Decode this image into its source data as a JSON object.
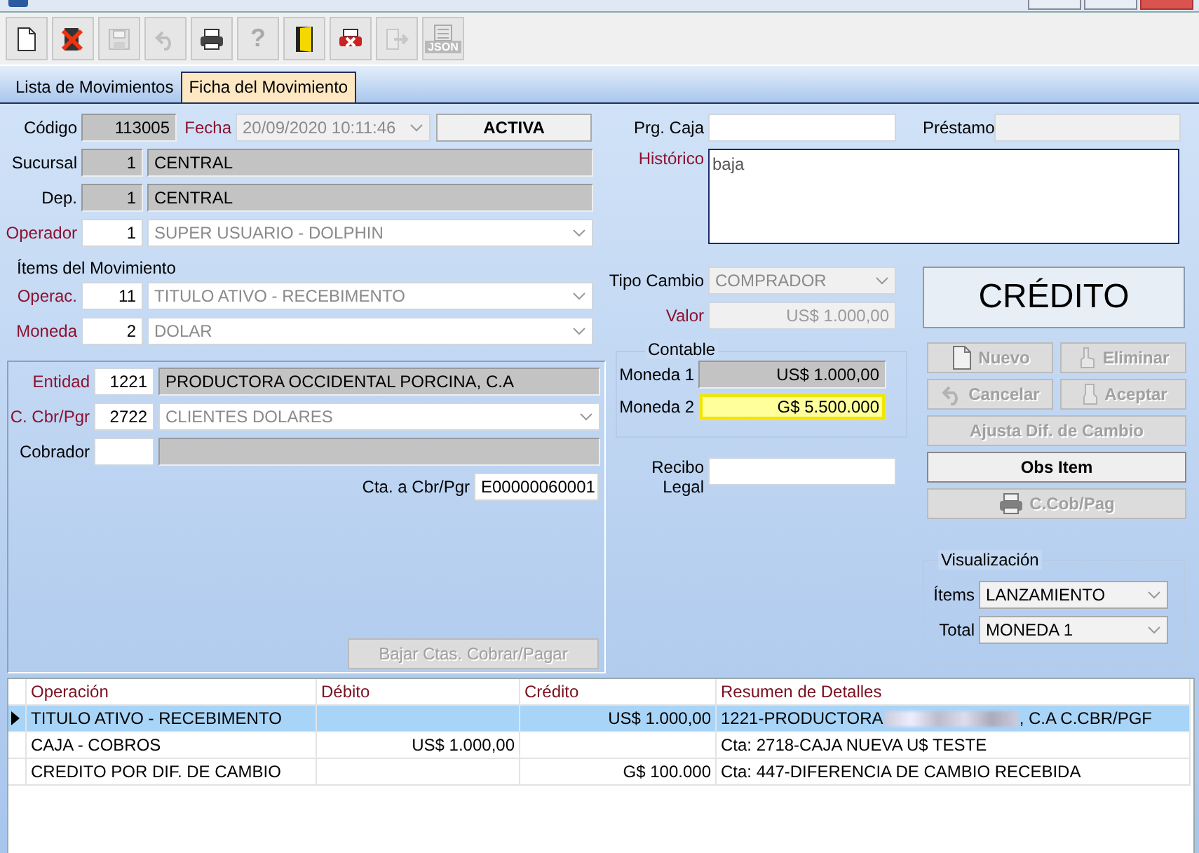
{
  "window": {
    "controls": [
      {
        "kind": "minimize"
      },
      {
        "kind": "maximize"
      },
      {
        "kind": "close"
      }
    ]
  },
  "toolbar": [
    {
      "kind": "new",
      "disabled": false
    },
    {
      "kind": "delete",
      "disabled": false
    },
    {
      "kind": "save",
      "disabled": true
    },
    {
      "kind": "undo",
      "disabled": true
    },
    {
      "kind": "print",
      "disabled": false
    },
    {
      "kind": "help",
      "label": "?",
      "disabled": true
    },
    {
      "kind": "exit",
      "disabled": false
    },
    {
      "kind": "print-cancel",
      "disabled": false
    },
    {
      "kind": "export",
      "disabled": true
    },
    {
      "kind": "json",
      "label": "JSON",
      "disabled": true
    }
  ],
  "tabs": [
    {
      "label": "Lista de Movimientos",
      "selected": false
    },
    {
      "label": "Ficha del Movimiento",
      "selected": true
    }
  ],
  "header": {
    "codigo": {
      "label": "Código",
      "required": false,
      "value": "113005"
    },
    "fecha": {
      "label": "Fecha",
      "required": true,
      "value": "20/09/2020 10:11:46"
    },
    "status": "ACTIVA",
    "sucursal": {
      "label": "Sucursal",
      "required": false,
      "code": "1",
      "value": "CENTRAL"
    },
    "dep": {
      "label": "Dep.",
      "required": false,
      "code": "1",
      "value": "CENTRAL"
    },
    "operador": {
      "label": "Operador",
      "required": true,
      "code": "1",
      "value": "SUPER USUARIO - DOLPHIN"
    },
    "prg_caja": {
      "label": "Prg. Caja",
      "required": false
    },
    "prestamo": {
      "label": "Préstamo",
      "required": false
    },
    "historico": {
      "label": "Histórico",
      "required": true,
      "value": "baja"
    }
  },
  "items": {
    "title": "Ítems del Movimiento",
    "operac": {
      "label": "Operac.",
      "required": true,
      "code": "11",
      "value": "TITULO ATIVO - RECEBIMENTO"
    },
    "moneda": {
      "label": "Moneda",
      "required": true,
      "code": "2",
      "value": "DOLAR"
    },
    "entidad": {
      "label": "Entidad",
      "required": true,
      "code": "1221",
      "value": "PRODUCTORA OCCIDENTAL PORCINA, C.A"
    },
    "cbr_pgr": {
      "label": "C. Cbr/Pgr",
      "required": true,
      "code": "2722",
      "value": "CLIENTES DOLARES"
    },
    "cobrador": {
      "label": "Cobrador",
      "required": false
    },
    "cta": {
      "label": "Cta. a Cbr/Pgr",
      "required": false,
      "value": "E00000060001"
    },
    "bajar_button": {
      "label": "Bajar Ctas. Cobrar/Pagar",
      "disabled": true
    },
    "tipo_cambio": {
      "label": "Tipo Cambio",
      "required": false,
      "value": "COMPRADOR"
    },
    "valor": {
      "label": "Valor",
      "required": true,
      "value": "US$ 1.000,00"
    },
    "contable": {
      "title": "Contable",
      "moneda1": {
        "label": "Moneda 1",
        "value": "US$ 1.000,00",
        "highlighted": false
      },
      "moneda2": {
        "label": "Moneda 2",
        "value": "G$ 5.500.000",
        "highlighted": true
      }
    },
    "recibo": {
      "label": "Recibo Legal",
      "required": false
    }
  },
  "side": {
    "type_label": "CRÉDITO",
    "buttons": [
      {
        "kind": "new",
        "label": "Nuevo",
        "disabled": true,
        "wide": false
      },
      {
        "kind": "delete",
        "label": "Eliminar",
        "disabled": true,
        "wide": false
      },
      {
        "kind": "cancel",
        "label": "Cancelar",
        "disabled": true,
        "wide": false
      },
      {
        "kind": "accept",
        "label": "Aceptar",
        "disabled": true,
        "wide": false
      },
      {
        "kind": "none",
        "label": "Ajusta Dif. de Cambio",
        "disabled": true,
        "wide": true
      },
      {
        "kind": "none",
        "label": "Obs Item",
        "disabled": false,
        "wide": true
      },
      {
        "kind": "print",
        "label": "C.Cob/Pag",
        "disabled": true,
        "wide": true
      }
    ],
    "visualizacion": {
      "title": "Visualización",
      "items": {
        "label": "Ítems",
        "value": "LANZAMIENTO"
      },
      "total": {
        "label": "Total",
        "value": "MONEDA 1"
      }
    }
  },
  "grid": {
    "columns": [
      "Operación",
      "Débito",
      "Crédito",
      "Resumen de Detalles"
    ],
    "rows": [
      {
        "selected": true,
        "operacion": "TITULO ATIVO - RECEBIMENTO",
        "debito": "",
        "credito": "US$ 1.000,00",
        "detail": "1221-PRODUCTORA",
        "detail_redacted": true,
        "detail_tail": ", C.A C.CBR/PGF"
      },
      {
        "selected": false,
        "operacion": "CAJA - COBROS",
        "debito": "US$ 1.000,00",
        "credito": "",
        "detail": "Cta: 2718-CAJA NUEVA U$ TESTE",
        "detail_redacted": false
      },
      {
        "selected": false,
        "operacion": "CREDITO POR DIF. DE CAMBIO",
        "debito": "",
        "credito": "G$ 100.000",
        "detail": "Cta: 447-DIFERENCIA DE CAMBIO RECEBIDA",
        "detail_redacted": false
      }
    ]
  }
}
